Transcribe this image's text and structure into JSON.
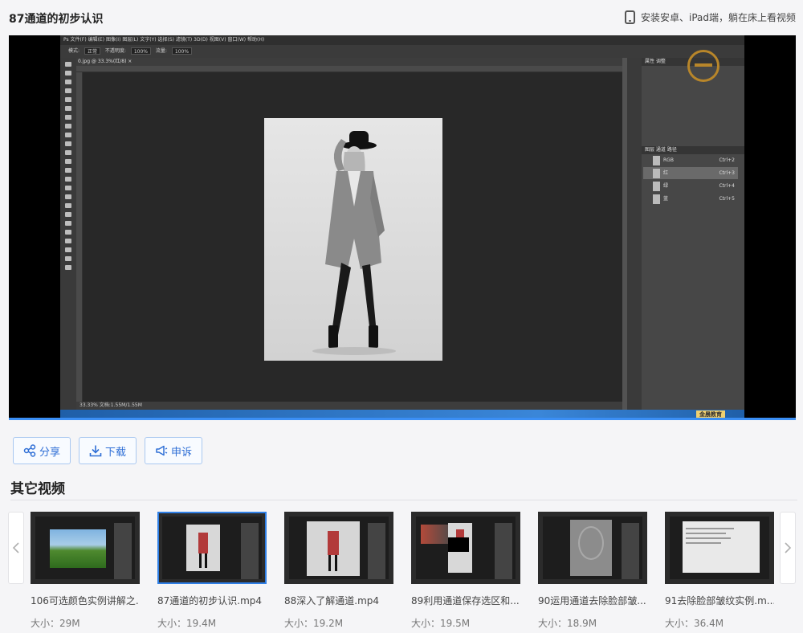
{
  "header": {
    "title": "87通道的初步认识",
    "mobile_hint": "安装安卓、iPad端，躺在床上看视频"
  },
  "player": {
    "ps_menu": "Ps  文件(F)  编辑(E)  图像(I)  图层(L)  文字(Y)  选择(S)  滤镜(T)  3D(D)  视图(V)  窗口(W)  帮助(H)",
    "ps_options": {
      "mode_label": "模式:",
      "mode_value": "正常",
      "opacity_label": "不透明度:",
      "opacity_value": "100%",
      "flow_label": "流量:",
      "flow_value": "100%"
    },
    "ps_tab": "0.jpg @ 33.3%(红/8) ×",
    "ps_status": "33.33%   文档:1.55M/1.55M",
    "panels": {
      "properties_head": "属性  调整",
      "channels_head": "图层  通道  路径",
      "channels": [
        {
          "name": "RGB",
          "key": "Ctrl+2"
        },
        {
          "name": "红",
          "key": "Ctrl+3"
        },
        {
          "name": "绿",
          "key": "Ctrl+4"
        },
        {
          "name": "蓝",
          "key": "Ctrl+5"
        }
      ]
    },
    "brand": "金晨教育"
  },
  "actions": {
    "share": "分享",
    "download": "下载",
    "report": "申诉"
  },
  "section_title": "其它视频",
  "videos": [
    {
      "title": "106可选颜色实例讲解之...",
      "size": "大小：29M"
    },
    {
      "title": "87通道的初步认识.mp4",
      "size": "大小：19.4M"
    },
    {
      "title": "88深入了解通道.mp4",
      "size": "大小：19.2M"
    },
    {
      "title": "89利用通道保存选区和...",
      "size": "大小：19.5M"
    },
    {
      "title": "90运用通道去除脸部皱...",
      "size": "大小：18.9M"
    },
    {
      "title": "91去除脸部皱纹实例.m...",
      "size": "大小：36.4M"
    }
  ],
  "colors": {
    "accent": "#2f7fe6",
    "progress": "#3b8ff5",
    "page_bg": "#f5f5f7"
  }
}
